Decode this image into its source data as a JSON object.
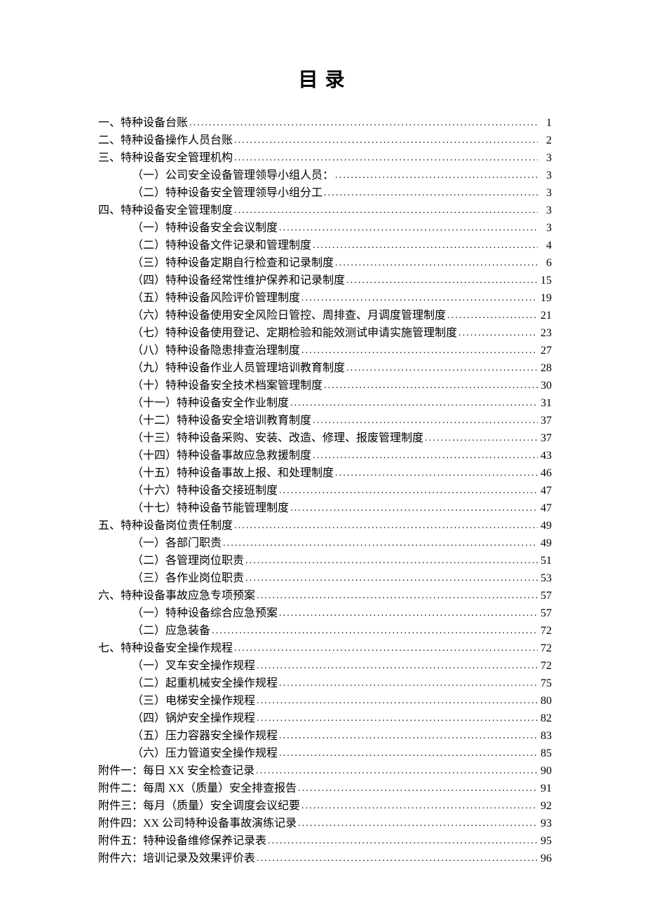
{
  "title": "目录",
  "toc": [
    {
      "level": 1,
      "label": "一、特种设备台账",
      "page": "1"
    },
    {
      "level": 1,
      "label": "二、特种设备操作人员台账",
      "page": "2"
    },
    {
      "level": 1,
      "label": "三、特种设备安全管理机构",
      "page": "3"
    },
    {
      "level": 2,
      "label": "（一）公司安全设备管理领导小组人员：",
      "page": "3"
    },
    {
      "level": 2,
      "label": "（二）特种设备安全管理领导小组分工",
      "page": "3"
    },
    {
      "level": 1,
      "label": "四、特种设备安全管理制度",
      "page": "3"
    },
    {
      "level": 2,
      "label": "（一）特种设备安全会议制度",
      "page": "3"
    },
    {
      "level": 2,
      "label": "（二）特种设备文件记录和管理制度",
      "page": "4"
    },
    {
      "level": 2,
      "label": "（三）特种设备定期自行检查和记录制度",
      "page": "6"
    },
    {
      "level": 2,
      "label": "（四）特种设备经常性维护保养和记录制度",
      "page": "15"
    },
    {
      "level": 2,
      "label": "（五）特种设备风险评价管理制度",
      "page": "19"
    },
    {
      "level": 2,
      "label": "（六）特种设备使用安全风险日管控、周排查、月调度管理制度",
      "page": "21"
    },
    {
      "level": 2,
      "label": "（七）特种设备使用登记、定期检验和能效测试申请实施管理制度",
      "page": "23"
    },
    {
      "level": 2,
      "label": "（八）特种设备隐患排查治理制度",
      "page": "27"
    },
    {
      "level": 2,
      "label": "（九）特种设备作业人员管理培训教育制度",
      "page": "28"
    },
    {
      "level": 2,
      "label": "（十）特种设备安全技术档案管理制度",
      "page": "30"
    },
    {
      "level": 2,
      "label": "（十一）特种设备安全作业制度",
      "page": "31"
    },
    {
      "level": 2,
      "label": "（十二）特种设备安全培训教育制度",
      "page": "37"
    },
    {
      "level": 2,
      "label": "（十三）特种设备采购、安装、改造、修理、报废管理制度",
      "page": "37"
    },
    {
      "level": 2,
      "label": "（十四）特种设备事故应急救援制度",
      "page": "43"
    },
    {
      "level": 2,
      "label": "（十五）特种设备事故上报、和处理制度",
      "page": "46"
    },
    {
      "level": 2,
      "label": "（十六）特种设备交接班制度",
      "page": "47"
    },
    {
      "level": 2,
      "label": "（十七）特种设备节能管理制度",
      "page": "47"
    },
    {
      "level": 1,
      "label": "五、特种设备岗位责任制度",
      "page": "49"
    },
    {
      "level": 2,
      "label": "（一）各部门职责",
      "page": "49"
    },
    {
      "level": 2,
      "label": "（二）各管理岗位职责",
      "page": "51"
    },
    {
      "level": 2,
      "label": "（三）各作业岗位职责",
      "page": "53"
    },
    {
      "level": 1,
      "label": "六、特种设备事故应急专项预案",
      "page": "57"
    },
    {
      "level": 2,
      "label": "（一）特种设备综合应急预案",
      "page": "57"
    },
    {
      "level": 2,
      "label": "（二）应急装备",
      "page": "72"
    },
    {
      "level": 1,
      "label": "七、特种设备安全操作规程",
      "page": "72"
    },
    {
      "level": 2,
      "label": "（一）叉车安全操作规程",
      "page": "72"
    },
    {
      "level": 2,
      "label": "（二）起重机械安全操作规程",
      "page": "75"
    },
    {
      "level": 2,
      "label": "（三）电梯安全操作规程",
      "page": "80"
    },
    {
      "level": 2,
      "label": "（四）锅炉安全操作规程",
      "page": "82"
    },
    {
      "level": 2,
      "label": "（五）压力容器安全操作规程",
      "page": "83"
    },
    {
      "level": 2,
      "label": "（六）压力管道安全操作规程",
      "page": "85"
    },
    {
      "level": 1,
      "label": "附件一：每日 XX 安全检查记录",
      "page": "90"
    },
    {
      "level": 1,
      "label": "附件二：每周 XX（质量）安全排查报告",
      "page": "91"
    },
    {
      "level": 1,
      "label": "附件三：每月（质量）安全调度会议纪要",
      "page": "92"
    },
    {
      "level": 1,
      "label": "附件四：XX 公司特种设备事故演练记录",
      "page": "93"
    },
    {
      "level": 1,
      "label": "附件五：特种设备维修保养记录表",
      "page": "95"
    },
    {
      "level": 1,
      "label": "附件六：培训记录及效果评价表",
      "page": "96"
    }
  ]
}
